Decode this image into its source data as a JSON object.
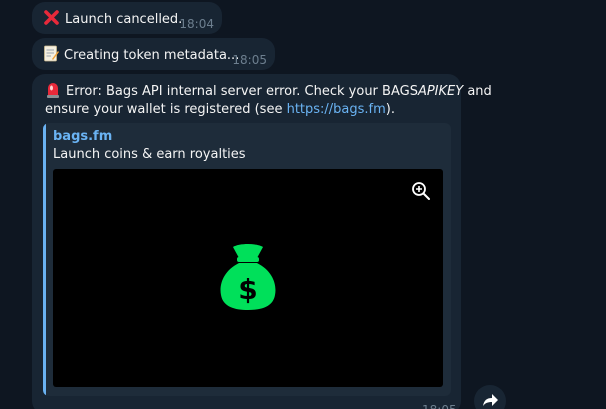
{
  "messages": [
    {
      "text": "Launch cancelled.",
      "time": "18:04",
      "icon": "cross-mark-icon"
    },
    {
      "text": "Creating token metadata...",
      "time": "18:05",
      "icon": "memo-icon"
    },
    {
      "icon": "police-light-icon",
      "line1": "Error: Bags API internal server error. Check your BAGS",
      "line1_italic": "APIKEY",
      "line1_end": " and",
      "line2_start": "ensure your wallet is registered (see ",
      "link": "https://bags.fm",
      "line2_end": ").",
      "time": "18:05"
    }
  ],
  "preview": {
    "site": "bags.fm",
    "description": "Launch coins & earn royalties",
    "image_icon": "money-bag-icon",
    "zoom_icon": "zoom-in-icon"
  },
  "colors": {
    "background": "#0e1621",
    "bubble": "#182533",
    "link": "#6ab3f3",
    "accent_green": "#00e05a"
  },
  "actions": {
    "forward_icon": "forward-icon"
  }
}
